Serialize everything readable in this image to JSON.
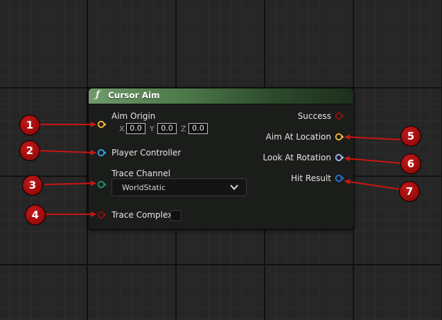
{
  "node": {
    "title": "Cursor Aim",
    "icon": "function-icon",
    "inputs": [
      {
        "label": "Aim Origin",
        "pin_color": "#e8b33a",
        "vector": {
          "x_label": "X",
          "x": "0.0",
          "y_label": "Y",
          "y": "0.0",
          "z_label": "Z",
          "z": "0.0"
        }
      },
      {
        "label": "Player Controller",
        "pin_color": "#2fa0e0"
      },
      {
        "label": "Trace Channel",
        "pin_color": "#1f8d6b",
        "dropdown_value": "WorldStatic"
      },
      {
        "label": "Trace Complex",
        "pin_color": "#8a1010"
      }
    ],
    "outputs": [
      {
        "label": "Success",
        "pin_color": "#8a1010"
      },
      {
        "label": "Aim At Location",
        "pin_color": "#e8b33a"
      },
      {
        "label": "Look At Rotation",
        "pin_color": "#9fb0e8"
      },
      {
        "label": "Hit Result",
        "pin_color": "#2a6fd6"
      }
    ]
  },
  "annotations": {
    "badges": [
      "1",
      "2",
      "3",
      "4",
      "5",
      "6",
      "7"
    ],
    "color": "#b01313"
  }
}
